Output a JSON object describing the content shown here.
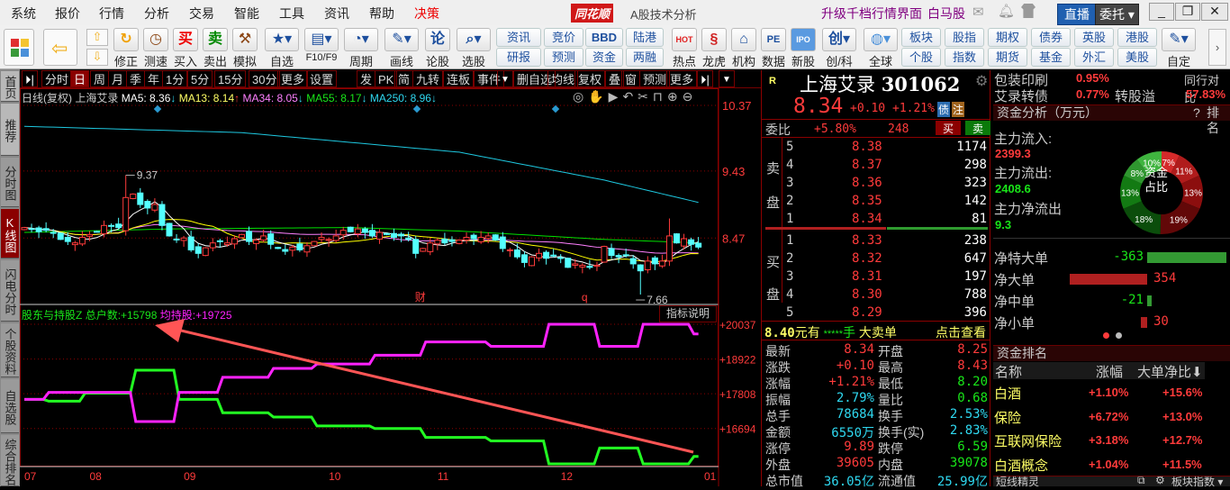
{
  "menu": {
    "items": [
      "系统",
      "报价",
      "行情",
      "分析",
      "交易",
      "智能",
      "工具",
      "资讯",
      "帮助",
      "决策"
    ],
    "logo": "同花顺",
    "title": "A股技术分析",
    "upgrade": "升级千档行情界面",
    "baima": "白马股",
    "live": "直播",
    "entrust": "委托"
  },
  "toolbar": {
    "icons": [
      "修正",
      "测速",
      "买入",
      "卖出",
      "模拟",
      "自选",
      "F10/F9",
      "周期",
      "画线",
      "论股",
      "选股"
    ],
    "buttons": [
      [
        "资讯",
        "研报"
      ],
      [
        "竞价",
        "预测"
      ],
      [
        "BBD",
        "资金"
      ],
      [
        "陆港",
        "两融"
      ]
    ],
    "icons2": [
      "热点",
      "龙虎",
      "机构",
      "数据",
      "新股",
      "创/科",
      "全球"
    ],
    "buttons2": [
      [
        "板块",
        "个股"
      ],
      [
        "股指",
        "指数"
      ],
      [
        "期权",
        "期货"
      ],
      [
        "债券",
        "基金"
      ],
      [
        "英股",
        "外汇"
      ],
      [
        "港股",
        "美股"
      ]
    ],
    "custom": "自定",
    "buy_glyph": "买",
    "sell_glyph": "卖",
    "lun_glyph": "论",
    "pe_glyph": "PE",
    "ipo_glyph": "IPO",
    "chuang_glyph": "创",
    "hot_glyph": "HOT"
  },
  "sidebar": [
    "首页",
    "推荐",
    "分时图",
    "K线图",
    "闪电分时",
    "个股资料",
    "自选股",
    "综合排名"
  ],
  "chart_tabs": {
    "left": [
      "分时",
      "日",
      "周",
      "月",
      "季",
      "年",
      "1分",
      "5分",
      "15分",
      "30分",
      "更多",
      "设置"
    ],
    "right": [
      "发",
      "PK",
      "简",
      "九转",
      "连板",
      "事件",
      "删自选",
      "均线",
      "复权",
      "叠",
      "窗",
      "预测",
      "更多"
    ],
    "selected": "日"
  },
  "legend": {
    "title": "日线(复权)",
    "name": "上海艾录",
    "ma5": "MA5: 8.36",
    "ma13": "MA13: 8.14",
    "ma34": "MA34: 8.05",
    "ma55": "MA55: 8.17",
    "ma250": "MA250: 8.96"
  },
  "chart_data": {
    "type": "candlestick",
    "price_axis": [
      "10.37",
      "9.43",
      "8.47"
    ],
    "ylim": [
      7.5,
      10.37
    ],
    "closes": [
      8.62,
      8.6,
      8.56,
      8.58,
      8.54,
      8.45,
      8.42,
      8.4,
      8.48,
      8.52,
      8.56,
      8.65,
      8.64,
      8.62,
      9.05,
      9.1,
      8.95,
      8.9,
      8.95,
      8.65,
      8.5,
      8.45,
      8.47,
      8.3,
      8.25,
      8.33,
      8.4,
      8.42,
      8.4,
      8.46,
      8.52,
      8.42,
      8.44,
      8.5,
      8.38,
      8.32,
      8.28,
      8.34,
      8.3,
      8.36,
      8.42,
      8.48,
      8.45,
      8.5,
      8.58,
      8.56,
      8.6,
      8.55,
      8.5,
      8.55,
      8.52,
      8.48,
      8.5,
      8.45,
      8.25,
      8.32,
      8.4,
      8.44,
      8.4,
      8.42,
      8.44,
      8.48,
      8.46,
      8.48,
      8.5,
      8.44,
      8.32,
      8.3,
      8.2,
      8.12,
      8.2,
      8.25,
      8.18,
      8.22,
      8.18,
      8.05,
      8.1,
      8.08,
      8.05,
      8.08,
      8.35,
      8.22,
      8.2,
      8.22,
      8.1,
      8.0,
      8.14,
      8.1,
      8.14,
      8.5,
      8.4,
      8.46,
      8.38,
      8.34
    ],
    "ma55": [
      [
        0,
        8.55
      ],
      [
        20,
        8.6
      ],
      [
        45,
        8.62
      ],
      [
        60,
        8.57
      ],
      [
        80,
        8.45
      ],
      [
        93,
        8.4
      ]
    ],
    "ma250": [
      [
        0,
        10.07
      ],
      [
        30,
        9.98
      ],
      [
        60,
        9.7
      ],
      [
        80,
        9.3
      ],
      [
        93,
        8.98
      ]
    ],
    "high_label": "9.37",
    "low_label": "7.66",
    "high_index": 14,
    "low_index": 85,
    "events": [
      {
        "index": 54,
        "label": "财"
      },
      {
        "index": 77,
        "label": "q"
      }
    ],
    "indicator": {
      "title": "股东与持股Z",
      "households_label": "总户数:",
      "households_value": "+15798",
      "avg_label": "均持股:",
      "avg_value": "+19725",
      "explain": "指标说明",
      "axis": [
        "+20037",
        "+18922",
        "+17808",
        "+16694"
      ],
      "ylim": [
        15400,
        20200
      ],
      "households": [
        [
          0,
          17627
        ],
        [
          3,
          17570
        ],
        [
          8,
          17826
        ],
        [
          15,
          18563
        ],
        [
          21,
          17627
        ],
        [
          27,
          17200
        ],
        [
          34,
          17060
        ],
        [
          40,
          16776
        ],
        [
          48,
          16692
        ],
        [
          55,
          16408
        ],
        [
          64,
          16295
        ],
        [
          72,
          15558
        ],
        [
          79,
          16068
        ],
        [
          85,
          15558
        ],
        [
          92,
          15798
        ]
      ],
      "avg_holdings": [
        [
          0,
          17627
        ],
        [
          3,
          17854
        ],
        [
          15,
          16918
        ],
        [
          21,
          17854
        ],
        [
          27,
          18336
        ],
        [
          34,
          18620
        ],
        [
          40,
          18763
        ],
        [
          48,
          19045
        ],
        [
          55,
          19470
        ],
        [
          64,
          19330
        ],
        [
          72,
          20037
        ],
        [
          79,
          19330
        ],
        [
          85,
          20037
        ],
        [
          92,
          19725
        ]
      ]
    },
    "x_ticks": [
      {
        "index": 0,
        "label": "07"
      },
      {
        "index": 9,
        "label": "08"
      },
      {
        "index": 22,
        "label": "09"
      },
      {
        "index": 42,
        "label": "10"
      },
      {
        "index": 57,
        "label": "11"
      },
      {
        "index": 74,
        "label": "12"
      },
      {
        "index": 94,
        "label": "01"
      }
    ]
  },
  "quote": {
    "r": "R",
    "name": "上海艾录",
    "code": "301062",
    "price": "8.34",
    "change": "+0.10",
    "pct": "+1.21%",
    "badge1": "债",
    "badge2": "注",
    "weibi_label": "委比",
    "weibi": "+5.80%",
    "weicha": "248",
    "buy": "买",
    "sell": "卖",
    "sell_side": [
      "卖",
      "盘"
    ],
    "buy_side": [
      "买",
      "盘"
    ],
    "asks": [
      [
        "5",
        "8.38",
        "1174"
      ],
      [
        "4",
        "8.37",
        "298"
      ],
      [
        "3",
        "8.36",
        "323"
      ],
      [
        "2",
        "8.35",
        "142"
      ],
      [
        "1",
        "8.34",
        "81"
      ]
    ],
    "bids": [
      [
        "1",
        "8.33",
        "238"
      ],
      [
        "2",
        "8.32",
        "647"
      ],
      [
        "3",
        "8.31",
        "197"
      ],
      [
        "4",
        "8.30",
        "788"
      ],
      [
        "5",
        "8.29",
        "396"
      ]
    ],
    "big_order": {
      "price": "8.40",
      "unit": "元有",
      "stars": "*****",
      "hand": "手",
      "type": "大卖单",
      "link": "点击查看"
    },
    "stats": [
      [
        "最新",
        "8.34",
        "red",
        "开盘",
        "8.25",
        "red"
      ],
      [
        "涨跌",
        "+0.10",
        "red",
        "最高",
        "8.43",
        "red"
      ],
      [
        "涨幅",
        "+1.21%",
        "red",
        "最低",
        "8.20",
        "grn"
      ],
      [
        "振幅",
        "2.79%",
        "cyan",
        "量比",
        "0.68",
        "grn"
      ],
      [
        "总手",
        "78684",
        "cyan",
        "换手",
        "2.53%",
        "cyan"
      ],
      [
        "金额",
        "6550万",
        "cyan",
        "换手(实)",
        "2.83%",
        "cyan"
      ],
      [
        "涨停",
        "9.89",
        "red",
        "跌停",
        "6.59",
        "grn"
      ],
      [
        "外盘",
        "39605",
        "red",
        "内盘",
        "39078",
        "grn"
      ],
      [
        "总市值",
        "36.05亿",
        "cyan",
        "流通值",
        "25.99亿",
        "cyan"
      ]
    ]
  },
  "right": {
    "industry": "包装印刷",
    "industry_pct": "0.95%",
    "compare": "同行对比",
    "bond": "艾录转债",
    "bond_pct": "0.77%",
    "premium_label": "转股溢",
    "premium": "57.83%",
    "fund_title": "资金分析（万元）",
    "help": "?",
    "rank": "排名",
    "inflow_label": "主力流入:",
    "inflow": "2399.3",
    "outflow_label": "主力流出:",
    "outflow": "2408.6",
    "net_label": "主力净流出",
    "net": "9.3",
    "donut_center": [
      "资金",
      "占比"
    ],
    "donut": [
      {
        "pct": 7,
        "color": "#d42a2a"
      },
      {
        "pct": 11,
        "color": "#b01c1c"
      },
      {
        "pct": 13,
        "color": "#8c0e0e"
      },
      {
        "pct": 19,
        "color": "#620808"
      },
      {
        "pct": 18,
        "color": "#0b4d0b"
      },
      {
        "pct": 13,
        "color": "#137a13"
      },
      {
        "pct": 8,
        "color": "#2f962f"
      },
      {
        "pct": 10,
        "color": "#3fb43f"
      }
    ],
    "flows": [
      {
        "label": "净特大单",
        "value": "-363",
        "num": -363
      },
      {
        "label": "净大单",
        "value": "354",
        "num": 354
      },
      {
        "label": "净中单",
        "value": "-21",
        "num": -21
      },
      {
        "label": "净小单",
        "value": "30",
        "num": 30
      }
    ],
    "rank_title": "资金排名",
    "rank_cols": [
      "名称",
      "涨幅",
      "大单净比"
    ],
    "rank_rows": [
      [
        "白酒",
        "+1.10%",
        "+15.6%"
      ],
      [
        "保险",
        "+6.72%",
        "+13.0%"
      ],
      [
        "互联网保险",
        "+3.18%",
        "+12.7%"
      ],
      [
        "白酒概念",
        "+1.04%",
        "+11.5%"
      ]
    ],
    "bottom": {
      "sprite": "短线精灵",
      "index": "板块指数"
    }
  },
  "colors": {
    "up": "#ff3b3b",
    "down": "#54ffff",
    "ma5": "#ffffff",
    "ma13": "#ffff00",
    "ma34": "#ff80ff",
    "ma55": "#00e000",
    "ma250": "#1ec8e0",
    "households": "#22ff22",
    "avg": "#ff22ff",
    "arrow": "#ff5555"
  }
}
